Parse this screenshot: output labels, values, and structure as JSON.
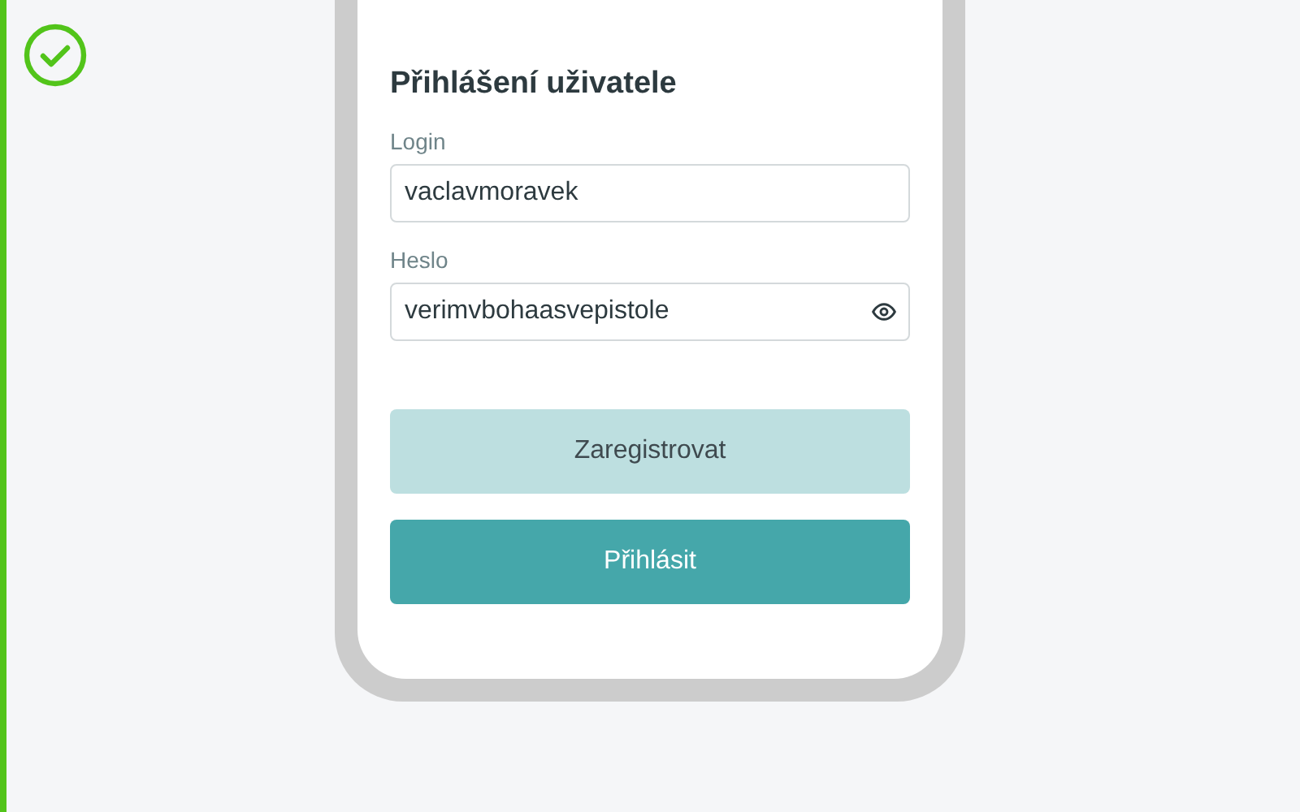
{
  "form": {
    "title": "Přihlášení uživatele",
    "fields": [
      {
        "label": "Login",
        "value": "vaclavmoravek",
        "kind": "text"
      },
      {
        "label": "Heslo",
        "value": "verimvbohaasvepistole",
        "kind": "password"
      }
    ],
    "buttons": [
      {
        "label": "Zaregistrovat",
        "kind": "secondary"
      },
      {
        "label": "Přihlásit",
        "kind": "primary"
      }
    ]
  }
}
